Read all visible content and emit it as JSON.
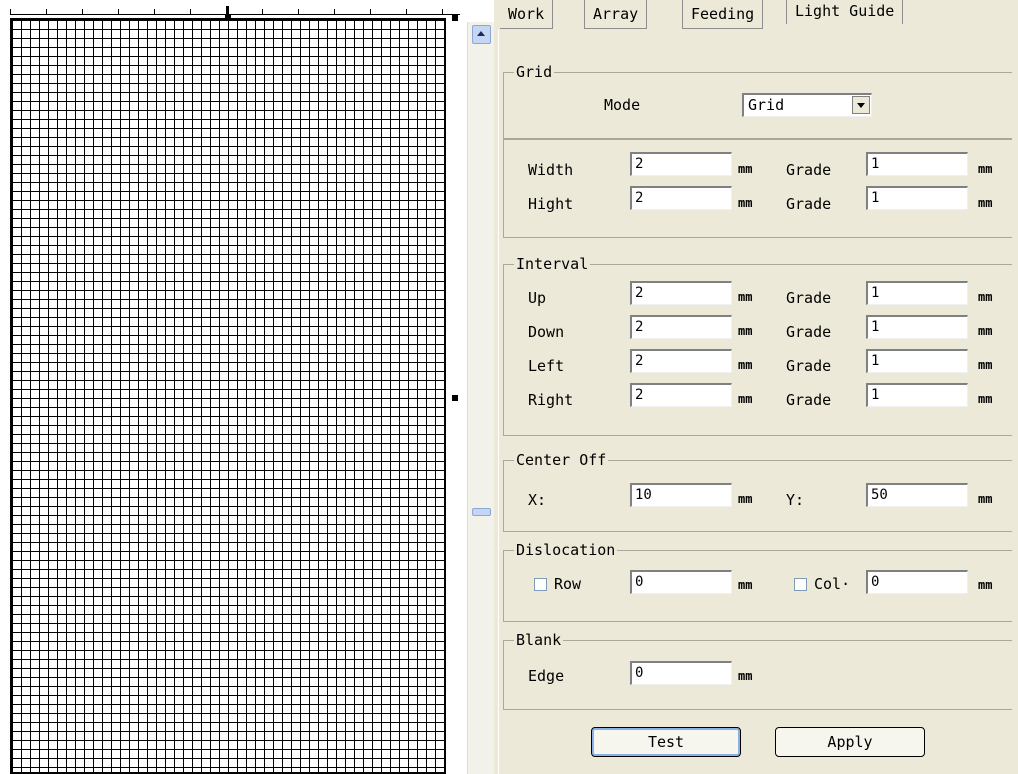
{
  "tabs": [
    {
      "label": "Work"
    },
    {
      "label": "Array"
    },
    {
      "label": "Feeding"
    },
    {
      "label": "Light Guide"
    }
  ],
  "grid": {
    "title": "Grid",
    "mode_label": "Mode",
    "mode_value": "Grid",
    "width_label": "Width",
    "width_value": "2",
    "width_grade_label": "Grade",
    "width_grade_value": "1",
    "hight_label": "Hight",
    "hight_value": "2",
    "hight_grade_label": "Grade",
    "hight_grade_value": "1",
    "unit": "mm"
  },
  "interval": {
    "title": "Interval",
    "rows": [
      {
        "label": "Up",
        "value": "2",
        "grade_label": "Grade",
        "grade_value": "1"
      },
      {
        "label": "Down",
        "value": "2",
        "grade_label": "Grade",
        "grade_value": "1"
      },
      {
        "label": "Left",
        "value": "2",
        "grade_label": "Grade",
        "grade_value": "1"
      },
      {
        "label": "Right",
        "value": "2",
        "grade_label": "Grade",
        "grade_value": "1"
      }
    ],
    "unit": "mm"
  },
  "center_off": {
    "title": "Center Off",
    "x_label": "X:",
    "x_value": "10",
    "y_label": "Y:",
    "y_value": "50",
    "unit": "mm"
  },
  "dislocation": {
    "title": "Dislocation",
    "row_label": "Row",
    "row_value": "0",
    "col_label": "Col·",
    "col_value": "0",
    "unit": "mm"
  },
  "blank": {
    "title": "Blank",
    "edge_label": "Edge",
    "edge_value": "0",
    "unit": "mm"
  },
  "buttons": {
    "test": "Test",
    "apply": "Apply"
  }
}
